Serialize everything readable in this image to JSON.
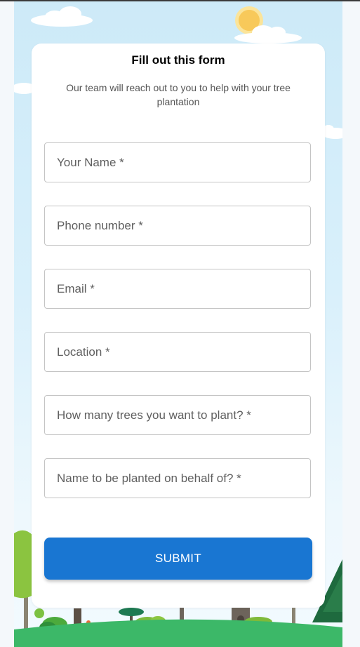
{
  "form": {
    "title": "Fill out this form",
    "subtitle": "Our team will reach out to you to help with your tree plantation",
    "fields": [
      {
        "placeholder": "Your Name *",
        "value": ""
      },
      {
        "placeholder": "Phone number *",
        "value": ""
      },
      {
        "placeholder": "Email *",
        "value": ""
      },
      {
        "placeholder": "Location *",
        "value": ""
      },
      {
        "placeholder": "How many trees you want to plant? *",
        "value": ""
      },
      {
        "placeholder": "Name to be planted on behalf of? *",
        "value": ""
      }
    ],
    "submit_label": "SUBMIT"
  },
  "colors": {
    "accent": "#1976d2",
    "sky": "#cdeaf8",
    "grass": "#3cb868",
    "sun": "#f8c95a"
  },
  "icons": [
    "sun-icon",
    "cloud-icon",
    "tree-icon"
  ]
}
